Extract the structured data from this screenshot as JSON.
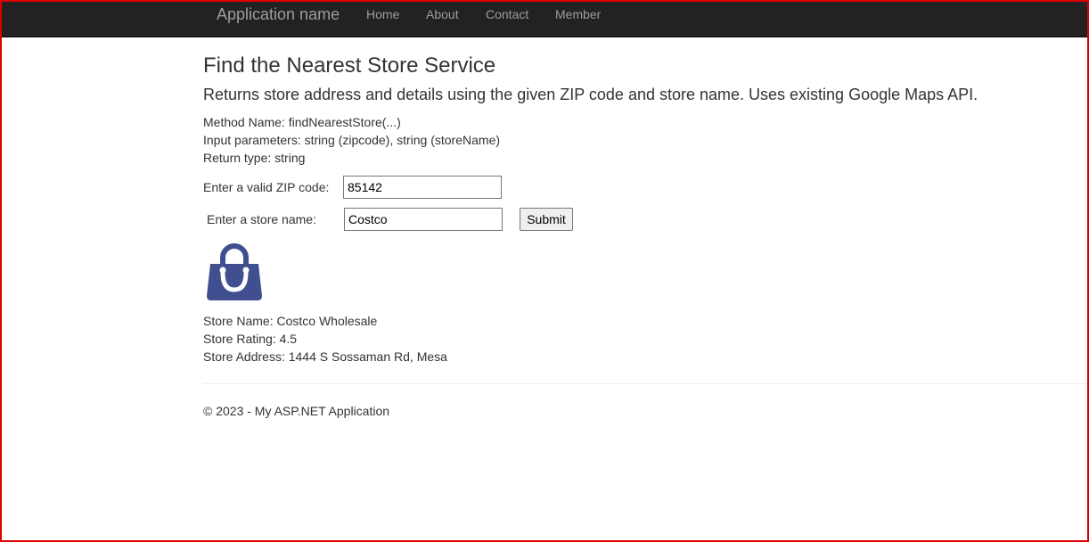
{
  "navbar": {
    "brand": "Application name",
    "links": [
      "Home",
      "About",
      "Contact",
      "Member"
    ]
  },
  "main": {
    "title": "Find the Nearest Store Service",
    "subtitle": "Returns store address and details using the given ZIP code and store name. Uses existing Google Maps API.",
    "method_name": "Method Name: findNearestStore(...)",
    "input_params": "Input parameters: string (zipcode), string (storeName)",
    "return_type": "Return type: string"
  },
  "form": {
    "zip_label": "Enter a valid ZIP code:",
    "zip_value": "85142",
    "store_label": "Enter a store name:",
    "store_value": "Costco",
    "submit_label": "Submit"
  },
  "result": {
    "icon": "shopping-bag-icon",
    "icon_color": "#3f4f8f",
    "store_name": "Store Name: Costco Wholesale",
    "store_rating": "Store Rating: 4.5",
    "store_address": "Store Address: 1444 S Sossaman Rd, Mesa"
  },
  "footer": {
    "text": "© 2023 - My ASP.NET Application"
  },
  "colors": {
    "navbar_bg": "#222222",
    "nav_text": "#9d9d9d",
    "frame_border": "#e00000"
  }
}
